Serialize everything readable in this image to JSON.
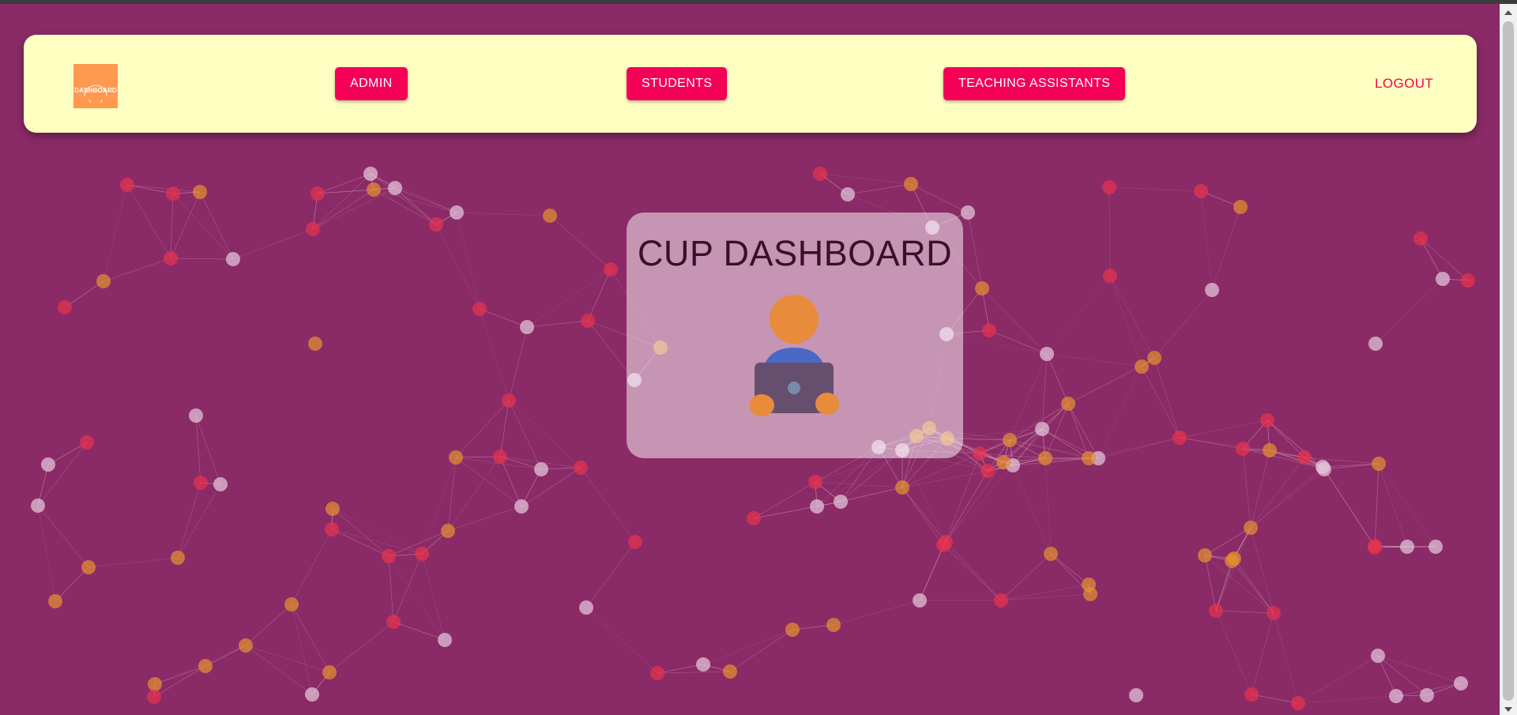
{
  "nav": {
    "logo_text": "DASHBOARD",
    "admin_label": "ADMIN",
    "students_label": "STUDENTS",
    "tas_label": "TEACHING ASSISTANTS",
    "logout_label": "LOGOUT"
  },
  "hero": {
    "title": "CUP DASHBOARD"
  },
  "colors": {
    "background": "#8a2a66",
    "navbar": "#ffffc2",
    "button": "#f50057",
    "logo": "#ff9950"
  }
}
